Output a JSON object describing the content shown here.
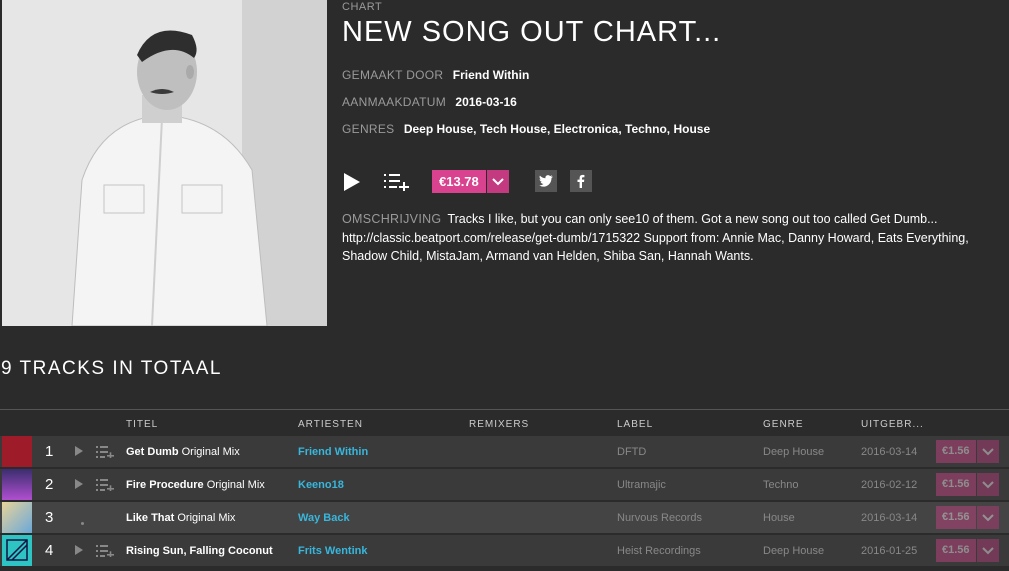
{
  "chart": {
    "kicker": "CHART",
    "title": "NEW SONG OUT CHART...",
    "made_by_label": "GEMAAKT DOOR",
    "made_by": "Friend Within",
    "created_label": "AANMAAKDATUM",
    "created": "2016-03-16",
    "genres_label": "GENRES",
    "genres": "Deep House, Tech House, Electronica, Techno, House",
    "price": "€13.78",
    "description_label": "OMSCHRIJVING",
    "description": "Tracks I like, but you can only see10 of them. Got a new song out too called Get Dumb... http://classic.beatport.com/release/get-dumb/1715322 Support from: Annie Mac, Danny Howard, Eats Everything, Shadow Child, MistaJam, Armand van Helden, Shiba San, Hannah Wants."
  },
  "tracks_total": "9 TRACKS IN TOTAAL",
  "columns": {
    "title": "TITEL",
    "artists": "ARTIESTEN",
    "remixers": "REMIXERS",
    "label": "LABEL",
    "genre": "GENRE",
    "released": "UITGEBR..."
  },
  "tracks": [
    {
      "num": "1",
      "name": "Get Dumb",
      "mix": "Original Mix",
      "artist": "Friend Within",
      "label": "DFTD",
      "genre": "Deep House",
      "date": "2016-03-14",
      "price": "€1.56",
      "thumb_color": "#9e1b2a"
    },
    {
      "num": "2",
      "name": "Fire Procedure",
      "mix": "Original Mix",
      "artist": "Keeno18",
      "label": "Ultramajic",
      "genre": "Techno",
      "date": "2016-02-12",
      "price": "€1.56",
      "thumb_color": "#6a3fa0"
    },
    {
      "num": "3",
      "name": "Like That",
      "mix": "Original Mix",
      "artist": "Way Back",
      "label": "Nurvous Records",
      "genre": "House",
      "date": "2016-03-14",
      "price": "€1.56",
      "thumb_color": "#d8c07a"
    },
    {
      "num": "4",
      "name": "Rising Sun, Falling Coconut",
      "mix": "",
      "artist": "Frits Wentink",
      "label": "Heist Recordings",
      "genre": "Deep House",
      "date": "2016-01-25",
      "price": "€1.56",
      "thumb_color": "#2fc4c4"
    }
  ],
  "colors": {
    "accent": "#d9428e",
    "artist_link": "#38b6dc",
    "background": "#2b2b2b"
  }
}
